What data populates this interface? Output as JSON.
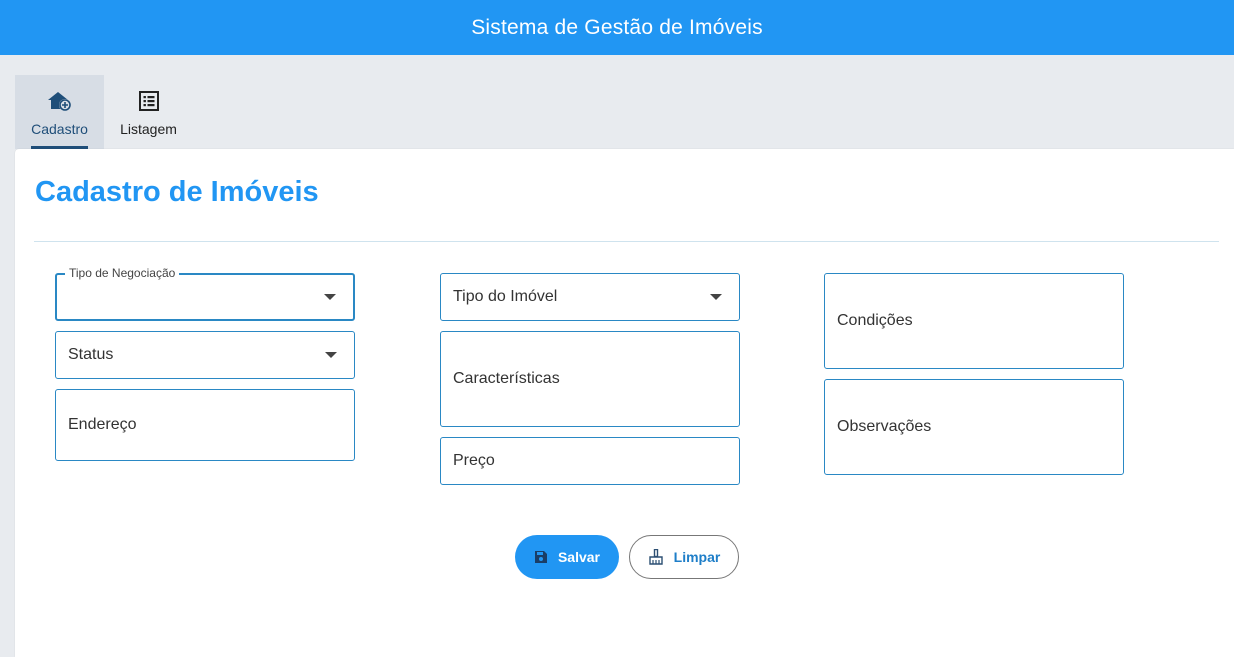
{
  "app": {
    "title": "Sistema de Gestão de Imóveis"
  },
  "tabs": [
    {
      "label": "Cadastro",
      "icon": "house-add-icon",
      "active": true
    },
    {
      "label": "Listagem",
      "icon": "list-icon",
      "active": false
    }
  ],
  "form": {
    "title": "Cadastro de Imóveis",
    "tipo_negociacao": {
      "label": "Tipo de Negociação",
      "value": ""
    },
    "status": {
      "placeholder": "Status"
    },
    "endereco": {
      "placeholder": "Endereço"
    },
    "tipo_imovel": {
      "placeholder": "Tipo do Imóvel"
    },
    "caracteristicas": {
      "placeholder": "Características"
    },
    "preco": {
      "placeholder": "Preço"
    },
    "condicoes": {
      "placeholder": "Condições"
    },
    "observacoes": {
      "placeholder": "Observações"
    }
  },
  "actions": {
    "save_label": "Salvar",
    "save_icon": "floppy-disk-icon",
    "clear_label": "Limpar",
    "clear_icon": "broom-icon"
  },
  "colors": {
    "primary": "#2196f3",
    "border": "#2a88c4",
    "tab_active_bg": "#d7dde5"
  }
}
